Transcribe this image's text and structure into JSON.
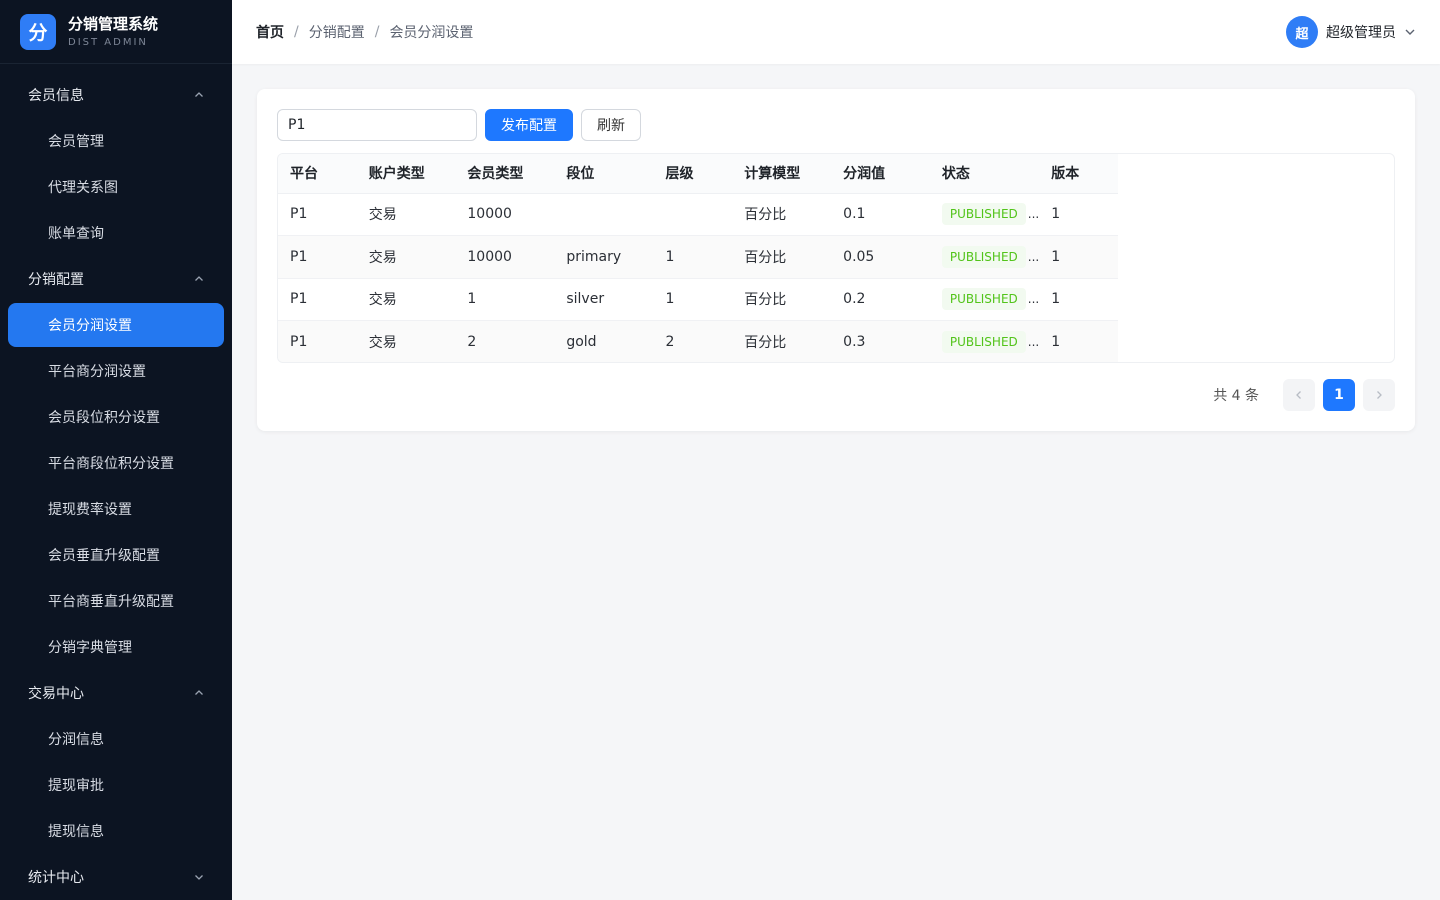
{
  "brand": {
    "logo_char": "分",
    "title": "分销管理系统",
    "subtitle": "DIST ADMIN"
  },
  "sidebar": {
    "groups": [
      {
        "label": "会员信息",
        "expanded": true,
        "items": [
          "会员管理",
          "代理关系图",
          "账单查询"
        ]
      },
      {
        "label": "分销配置",
        "expanded": true,
        "items": [
          "会员分润设置",
          "平台商分润设置",
          "会员段位积分设置",
          "平台商段位积分设置",
          "提现费率设置",
          "会员垂直升级配置",
          "平台商垂直升级配置",
          "分销字典管理"
        ]
      },
      {
        "label": "交易中心",
        "expanded": true,
        "items": [
          "分润信息",
          "提现审批",
          "提现信息"
        ]
      },
      {
        "label": "统计中心",
        "expanded": false,
        "items": []
      }
    ],
    "active_item": "会员分润设置"
  },
  "header": {
    "breadcrumb": [
      "首页",
      "分销配置",
      "会员分润设置"
    ],
    "separator": "/",
    "user": {
      "avatar_char": "超",
      "name": "超级管理员"
    }
  },
  "toolbar": {
    "search_value": "P1",
    "publish_label": "发布配置",
    "refresh_label": "刷新"
  },
  "table": {
    "columns": [
      "平台",
      "账户类型",
      "会员类型",
      "段位",
      "层级",
      "计算模型",
      "分润值",
      "状态",
      "版本"
    ],
    "rows": [
      [
        "P1",
        "交易",
        "10000",
        "",
        "",
        "百分比",
        "0.1",
        "PUBLISHED",
        "1"
      ],
      [
        "P1",
        "交易",
        "10000",
        "primary",
        "1",
        "百分比",
        "0.05",
        "PUBLISHED",
        "1"
      ],
      [
        "P1",
        "交易",
        "1",
        "silver",
        "1",
        "百分比",
        "0.2",
        "PUBLISHED",
        "1"
      ],
      [
        "P1",
        "交易",
        "2",
        "gold",
        "2",
        "百分比",
        "0.3",
        "PUBLISHED",
        "1"
      ]
    ],
    "ellipsis": "..."
  },
  "pagination": {
    "total_text": "共 4 条",
    "current_page": "1",
    "prev_icon": "chevron-left-icon",
    "next_icon": "chevron-right-icon"
  },
  "colors": {
    "sidebar_bg": "#0c1422",
    "primary": "#1e78ff",
    "active_menu": "#2478f0",
    "tag_text": "#52c41a",
    "tag_bg": "#f2faf0"
  }
}
